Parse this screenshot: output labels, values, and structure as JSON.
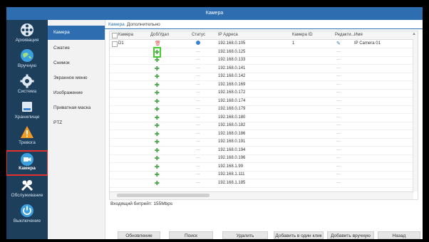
{
  "window": {
    "title": "Камера"
  },
  "nav": [
    {
      "label": "Архивация",
      "icon": "film-reel-icon"
    },
    {
      "label": "Вручную",
      "icon": "globe-icon"
    },
    {
      "label": "Система",
      "icon": "gear-icon"
    },
    {
      "label": "Хранилище",
      "icon": "hard-drive-icon"
    },
    {
      "label": "Тревога",
      "icon": "warning-icon"
    },
    {
      "label": "Камера",
      "icon": "camera-icon",
      "active": true
    },
    {
      "label": "Обслуживание",
      "icon": "tools-icon"
    },
    {
      "label": "Выключение",
      "icon": "power-icon"
    }
  ],
  "submenu": [
    "Камера",
    "Сжатие",
    "Снимок",
    "Экранное меню",
    "Изображение",
    "Приватная маска",
    "PTZ"
  ],
  "tabs": [
    "Камера",
    "Дополнительно"
  ],
  "table": {
    "headers": [
      "Камера",
      "Доб/Удал",
      "Статус",
      "IP Адреса",
      "Камера ID",
      "Редакти...",
      "Имя"
    ],
    "rows": [
      {
        "camera": "D1",
        "action": "trash",
        "status": "dot",
        "ip": "192.168.0.105",
        "id": "1",
        "edit": "pen",
        "name": "IP Camera 01"
      },
      {
        "camera": "",
        "action": "plus",
        "status": "—",
        "ip": "192.168.0.125",
        "id": "",
        "edit": "",
        "name": ""
      },
      {
        "camera": "",
        "action": "plus",
        "status": "—",
        "ip": "192.168.0.133",
        "id": "",
        "edit": "",
        "name": ""
      },
      {
        "camera": "",
        "action": "plus",
        "status": "—",
        "ip": "192.168.0.141",
        "id": "",
        "edit": "",
        "name": ""
      },
      {
        "camera": "",
        "action": "plus",
        "status": "—",
        "ip": "192.168.0.142",
        "id": "",
        "edit": "",
        "name": ""
      },
      {
        "camera": "",
        "action": "plus",
        "status": "—",
        "ip": "192.168.0.169",
        "id": "",
        "edit": "",
        "name": ""
      },
      {
        "camera": "",
        "action": "plus",
        "status": "—",
        "ip": "192.168.0.172",
        "id": "",
        "edit": "",
        "name": ""
      },
      {
        "camera": "",
        "action": "plus",
        "status": "—",
        "ip": "192.168.0.174",
        "id": "",
        "edit": "",
        "name": ""
      },
      {
        "camera": "",
        "action": "plus",
        "status": "—",
        "ip": "192.168.0.179",
        "id": "",
        "edit": "",
        "name": ""
      },
      {
        "camera": "",
        "action": "plus",
        "status": "—",
        "ip": "192.168.0.180",
        "id": "",
        "edit": "",
        "name": ""
      },
      {
        "camera": "",
        "action": "plus",
        "status": "—",
        "ip": "192.168.0.182",
        "id": "",
        "edit": "",
        "name": ""
      },
      {
        "camera": "",
        "action": "plus",
        "status": "—",
        "ip": "192.168.0.186",
        "id": "",
        "edit": "",
        "name": ""
      },
      {
        "camera": "",
        "action": "plus",
        "status": "—",
        "ip": "192.168.0.191",
        "id": "",
        "edit": "",
        "name": ""
      },
      {
        "camera": "",
        "action": "plus",
        "status": "—",
        "ip": "192.168.0.194",
        "id": "",
        "edit": "",
        "name": ""
      },
      {
        "camera": "",
        "action": "plus",
        "status": "—",
        "ip": "192.168.0.196",
        "id": "",
        "edit": "",
        "name": ""
      },
      {
        "camera": "",
        "action": "plus",
        "status": "—",
        "ip": "192.168.1.99",
        "id": "",
        "edit": "",
        "name": ""
      },
      {
        "camera": "",
        "action": "plus",
        "status": "—",
        "ip": "192.168.1.111",
        "id": "",
        "edit": "",
        "name": ""
      },
      {
        "camera": "",
        "action": "plus",
        "status": "—",
        "ip": "192.168.1.185",
        "id": "",
        "edit": "",
        "name": ""
      }
    ]
  },
  "bitrate": "Входящий битрейт: 155Mbps",
  "buttons": [
    "Обновление",
    "Поиск",
    "Удалить",
    "Добавить в один клик",
    "Добавить вручную",
    "Назад"
  ],
  "colors": {
    "accent": "#2e6eb0",
    "nav_bg": "#1e3f5c",
    "highlight_green": "#3fcf2c",
    "highlight_red": "#e53030"
  }
}
